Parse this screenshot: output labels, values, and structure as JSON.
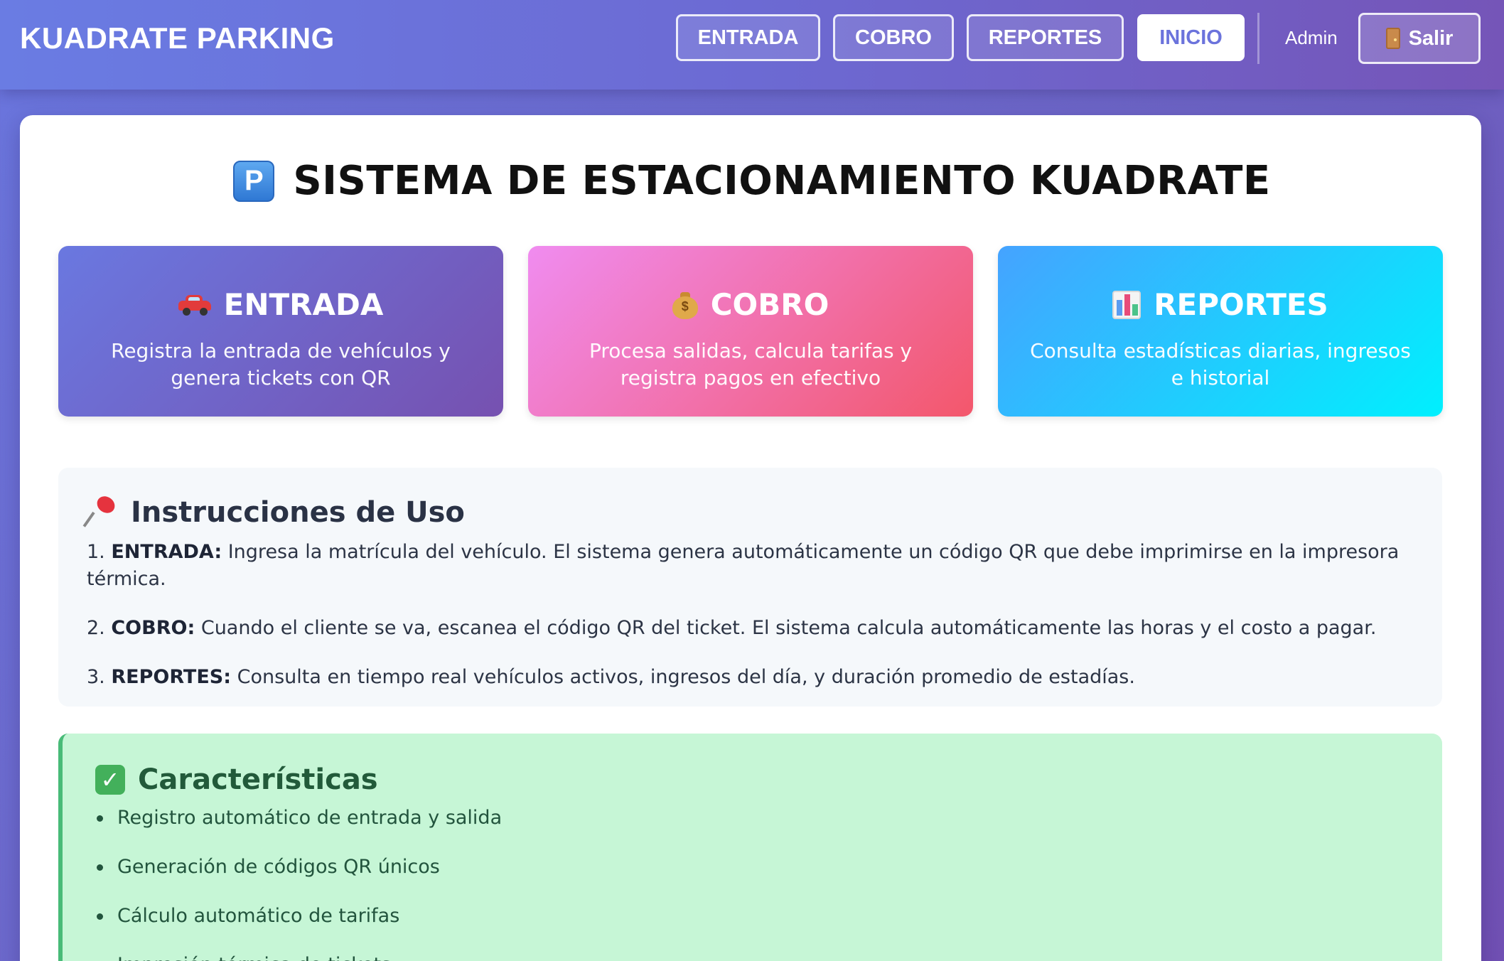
{
  "header": {
    "brand": "KUADRATE PARKING",
    "nav": [
      {
        "label": "ENTRADA",
        "active": false
      },
      {
        "label": "COBRO",
        "active": false
      },
      {
        "label": "REPORTES",
        "active": false
      },
      {
        "label": "INICIO",
        "active": true
      }
    ],
    "user": "Admin",
    "logout_label": "Salir",
    "logout_icon": "door-icon"
  },
  "main": {
    "title": "SISTEMA DE ESTACIONAMIENTO KUADRATE",
    "title_icon": "parking-icon",
    "tiles": [
      {
        "icon": "car-icon",
        "title": "ENTRADA",
        "desc": "Registra la entrada de vehículos y genera tickets con QR"
      },
      {
        "icon": "money-bag-icon",
        "title": "COBRO",
        "desc": "Procesa salidas, calcula tarifas y registra pagos en efectivo"
      },
      {
        "icon": "bar-chart-icon",
        "title": "REPORTES",
        "desc": "Consulta estadísticas diarias, ingresos e historial"
      }
    ],
    "instructions": {
      "icon": "pushpin-icon",
      "title": "Instrucciones de Uso",
      "steps": [
        {
          "num": "1.",
          "label": "ENTRADA:",
          "text": "Ingresa la matrícula del vehículo. El sistema genera automáticamente un código QR que debe imprimirse en la impresora térmica."
        },
        {
          "num": "2.",
          "label": "COBRO:",
          "text": "Cuando el cliente se va, escanea el código QR del ticket. El sistema calcula automáticamente las horas y el costo a pagar."
        },
        {
          "num": "3.",
          "label": "REPORTES:",
          "text": "Consulta en tiempo real vehículos activos, ingresos del día, y duración promedio de estadías."
        }
      ]
    },
    "features": {
      "icon": "check-icon",
      "title": "Características",
      "items": [
        "Registro automático de entrada y salida",
        "Generación de códigos QR únicos",
        "Cálculo automático de tarifas",
        "Impresión térmica de tickets"
      ]
    }
  },
  "colors": {
    "accent": "#6b73dc",
    "tile_entrada": "#6a78e0",
    "tile_cobro": "#f08cf0",
    "tile_reportes": "#45a3ff",
    "features_bg": "#c6f6d6",
    "features_border": "#48bb78"
  }
}
